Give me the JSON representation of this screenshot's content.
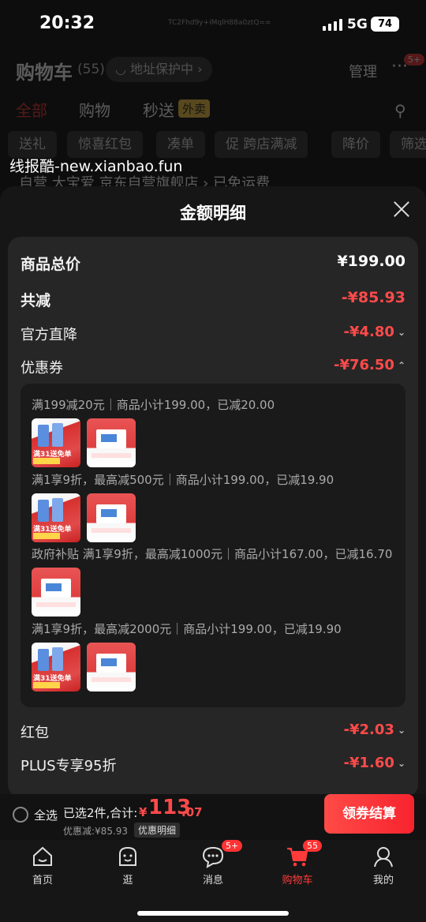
{
  "status_bar": {
    "time": "20:32",
    "network": "5G",
    "battery": "74",
    "faint_text": "TC2Fhd9y+iMqlH88a0ztQ=="
  },
  "background": {
    "title": "购物车",
    "count": "(55)",
    "address": "◡ 地址保护中 ›",
    "manage": "管理",
    "more": "···",
    "more_badge": "5+",
    "tabs": [
      "全部",
      "购物",
      "秒送"
    ],
    "waimai": "外卖",
    "chips": [
      "送礼",
      "惊喜红包",
      "凑单",
      "促 跨店满减",
      "降价",
      "筛选"
    ],
    "shop_row": "自营 大宝爱 京东自营旗舰店 ›   已免运费"
  },
  "watermark": "线报酷-new.xianbao.fun",
  "sheet": {
    "title": "金额明细",
    "rows": {
      "total": {
        "label": "商品总价",
        "value": "¥199.00"
      },
      "reduce": {
        "label": "共减",
        "value": "-¥85.93"
      },
      "official": {
        "label": "官方直降",
        "value": "-¥4.80"
      },
      "coupon": {
        "label": "优惠券",
        "value": "-¥76.50"
      },
      "redpacket": {
        "label": "红包",
        "value": "-¥2.03"
      },
      "plus": {
        "label": "PLUS专享95折",
        "value": "-¥1.60"
      }
    },
    "coupon_lines": [
      "满199减20元｜商品小计199.00，已减20.00",
      "满1享9折，最高减500元｜商品小计199.00，已减19.90",
      "政府补贴 满1享9折，最高减1000元｜商品小计167.00，已减16.70",
      "满1享9折，最高减2000元｜商品小计199.00，已减19.90"
    ],
    "thumb_text": {
      "a": "满31送免单",
      "b": "美国进口 内外同配"
    }
  },
  "checkout": {
    "select_all": "全选",
    "selected": "已选2件,合计:",
    "price_symbol": "¥",
    "price_int": "113",
    "price_dec": ".07",
    "discount": "优惠减:¥85.93",
    "detail": "优惠明细",
    "button": "领券结算"
  },
  "tabbar": {
    "items": [
      {
        "label": "首页",
        "icon": "home-icon"
      },
      {
        "label": "逛",
        "icon": "explore-icon"
      },
      {
        "label": "消息",
        "icon": "message-icon",
        "badge": "5+"
      },
      {
        "label": "购物车",
        "icon": "cart-icon",
        "badge": "55"
      },
      {
        "label": "我的",
        "icon": "profile-icon"
      }
    ]
  },
  "colors": {
    "accent": "#ff4a4a",
    "sheet": "#161616",
    "card": "#262626"
  }
}
